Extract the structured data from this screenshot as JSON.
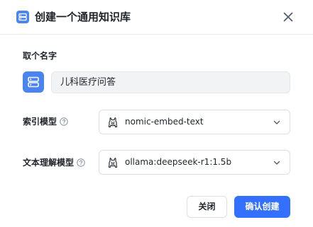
{
  "dialog": {
    "title": "创建一个通用知识库",
    "accent_color": "#3370ff"
  },
  "name_section": {
    "label": "取个名字",
    "value": "儿科医疗问答",
    "icon": "database-icon"
  },
  "index_model": {
    "label": "索引模型",
    "value": "nomic-embed-text",
    "icon": "llama-icon"
  },
  "text_model": {
    "label": "文本理解模型",
    "value": "ollama:deepseek-r1:1.5b",
    "icon": "llama-icon"
  },
  "buttons": {
    "cancel": "关闭",
    "confirm": "确认创建"
  }
}
